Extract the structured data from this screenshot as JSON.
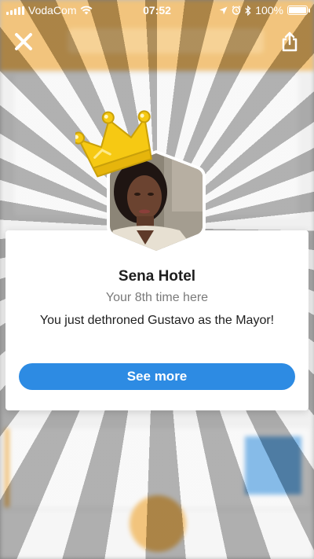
{
  "status_bar": {
    "carrier": "VodaCom",
    "time": "07:52",
    "battery": "100%"
  },
  "top_bar": {
    "close_icon": "close-icon",
    "share_icon": "share-icon"
  },
  "modal": {
    "venue_name": "Sena Hotel",
    "visit_text": "Your 8th time here",
    "message": "You just dethroned Gustavo as the Mayor!",
    "button_label": "See more",
    "button_color": "#2d8be3"
  },
  "colors": {
    "brand_orange": "#e89a1f",
    "crown_yellow": "#f6c913"
  }
}
